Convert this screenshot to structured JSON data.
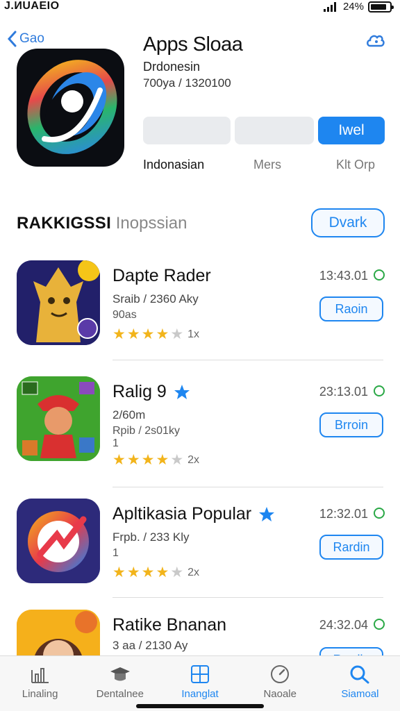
{
  "status": {
    "time": "J.ИUAEIO",
    "battery": "24%",
    "battery_level": 0.85
  },
  "header": {
    "back_label": "Gao",
    "app_title": "Apps Sloaa",
    "app_subtitle": "Drdonesin",
    "app_meta": "700ya / 1320100",
    "action_button": "Iwel",
    "info_labels": [
      "Indonasian",
      "Mers",
      "Klt Orp"
    ]
  },
  "section": {
    "title_strong": "RAKKIGSSI",
    "title_light": "Inopssian",
    "button": "Dvark"
  },
  "apps": [
    {
      "name": "Dapte Rader",
      "line1": "Sraib / 2360 Aky",
      "line2": "90as",
      "stars": 4,
      "count": "1x",
      "time": "13:43.01",
      "button": "Raoin"
    },
    {
      "name": "Ralig 9",
      "line1": "2/60m",
      "line2": "Rpib / 2s01ky",
      "line3": "1",
      "stars": 4,
      "count": "2x",
      "time": "23:13.01",
      "button": "Brroin"
    },
    {
      "name": "Apltikasia Popular",
      "line1": "Frpb. / 233 Kly",
      "line2": "1",
      "stars": 4,
      "count": "2x",
      "time": "12:32.01",
      "button": "Rardin"
    },
    {
      "name": "Ratike Bnanan",
      "line1": "3 aa / 2130 Ay",
      "time": "24:32.04",
      "button": "Rardin"
    }
  ],
  "tabs": [
    {
      "label": "Linaling",
      "icon": "chart-icon"
    },
    {
      "label": "Dentalnee",
      "icon": "graduation-cap-icon"
    },
    {
      "label": "Inanglat",
      "icon": "grid-icon"
    },
    {
      "label": "Naoale",
      "icon": "gauge-icon"
    },
    {
      "label": "Siamoal",
      "icon": "search-icon"
    }
  ],
  "colors": {
    "accent": "#1e86f0",
    "star": "#f2b41b",
    "status_green": "#29a845"
  }
}
